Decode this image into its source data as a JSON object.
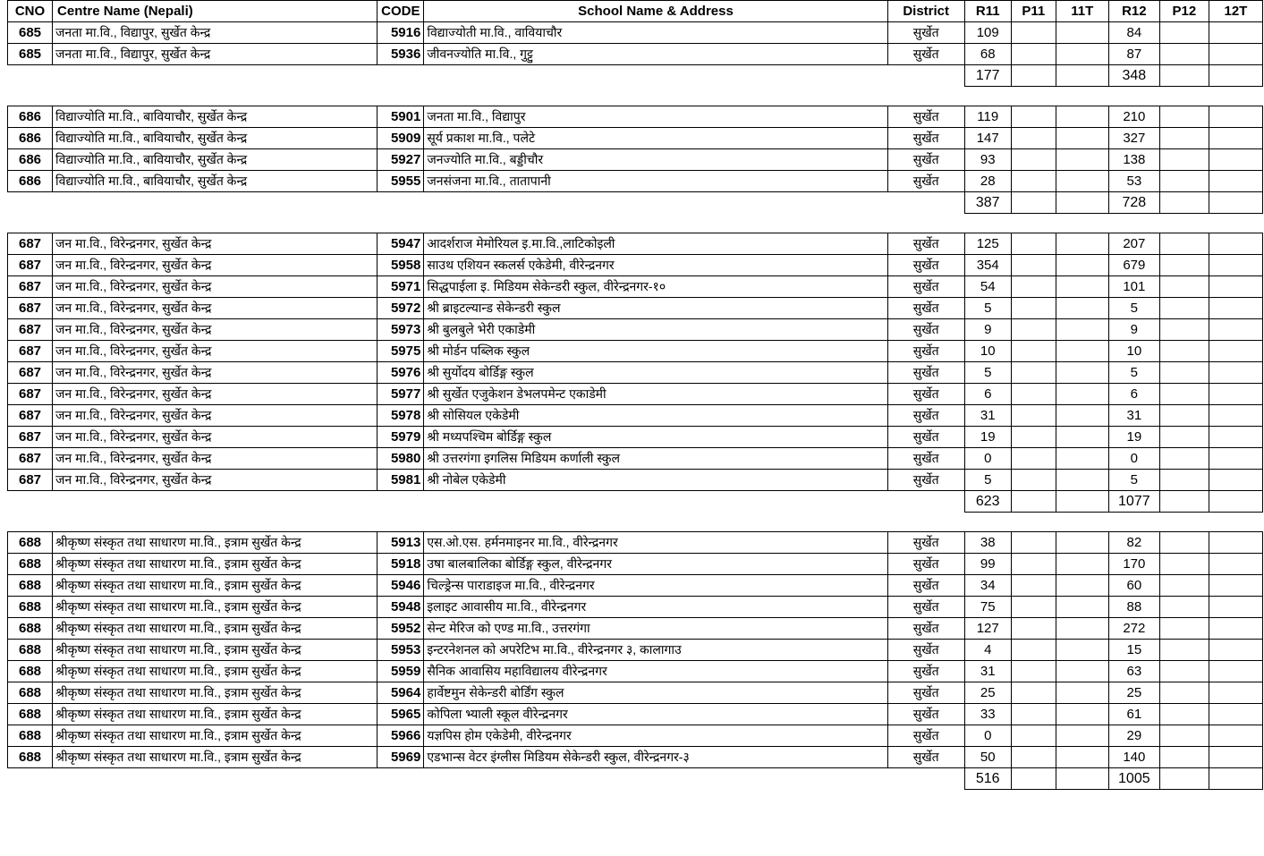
{
  "table": {
    "columns": [
      {
        "key": "cno",
        "label": "CNO"
      },
      {
        "key": "centre",
        "label": "Centre Name (Nepali)"
      },
      {
        "key": "code",
        "label": "CODE"
      },
      {
        "key": "school",
        "label": "School Name & Address"
      },
      {
        "key": "dist",
        "label": "District"
      },
      {
        "key": "r11",
        "label": "R11"
      },
      {
        "key": "p11",
        "label": "P11"
      },
      {
        "key": "t11",
        "label": "11T"
      },
      {
        "key": "r12",
        "label": "R12"
      },
      {
        "key": "p12",
        "label": "P12"
      },
      {
        "key": "t12",
        "label": "12T"
      }
    ],
    "blocks": [
      {
        "cno": "685",
        "centre": "जनता मा.वि., विद्यापुर, सुर्खेत केन्द्र",
        "rows": [
          {
            "code": "5916",
            "school": "विद्याज्योती मा.वि., वावियाचौर",
            "dist": "सुर्खेत",
            "r11": "109",
            "p11": "",
            "t11": "",
            "r12": "84",
            "p12": "",
            "t12": ""
          },
          {
            "code": "5936",
            "school": "जीवनज्योति मा.वि., गुट्टु",
            "dist": "सुर्खेत",
            "r11": "68",
            "p11": "",
            "t11": "",
            "r12": "87",
            "p12": "",
            "t12": ""
          }
        ],
        "total": {
          "r11": "177",
          "p11": "",
          "t11": "",
          "r12": "348",
          "p12": "",
          "t12": ""
        }
      },
      {
        "cno": "686",
        "centre": "विद्याज्योति मा.वि., बावियाचौर, सुर्खेत केन्द्र",
        "rows": [
          {
            "code": "5901",
            "school": "जनता मा.वि., विद्यापुर",
            "dist": "सुर्खेत",
            "r11": "119",
            "p11": "",
            "t11": "",
            "r12": "210",
            "p12": "",
            "t12": ""
          },
          {
            "code": "5909",
            "school": "सूर्य प्रकाश मा.वि., पलेटे",
            "dist": "सुर्खेत",
            "r11": "147",
            "p11": "",
            "t11": "",
            "r12": "327",
            "p12": "",
            "t12": ""
          },
          {
            "code": "5927",
            "school": "जनज्योति मा.वि., बड्डीचौर",
            "dist": "सुर्खेत",
            "r11": "93",
            "p11": "",
            "t11": "",
            "r12": "138",
            "p12": "",
            "t12": ""
          },
          {
            "code": "5955",
            "school": "जनसंजना मा.वि., तातापानी",
            "dist": "सुर्खेत",
            "r11": "28",
            "p11": "",
            "t11": "",
            "r12": "53",
            "p12": "",
            "t12": ""
          }
        ],
        "total": {
          "r11": "387",
          "p11": "",
          "t11": "",
          "r12": "728",
          "p12": "",
          "t12": ""
        }
      },
      {
        "cno": "687",
        "centre": "जन मा.वि., विरेन्द्रनगर, सुर्खेत केन्द्र",
        "rows": [
          {
            "code": "5947",
            "school": "आदर्शराज मेमोरियल इ.मा.वि.,लाटिकोइली",
            "dist": "सुर्खेत",
            "r11": "125",
            "p11": "",
            "t11": "",
            "r12": "207",
            "p12": "",
            "t12": ""
          },
          {
            "code": "5958",
            "school": "साउथ एशियन स्कलर्स एकेडेमी, वीरेन्द्रनगर",
            "dist": "सुर्खेत",
            "r11": "354",
            "p11": "",
            "t11": "",
            "r12": "679",
            "p12": "",
            "t12": ""
          },
          {
            "code": "5971",
            "school": "सिद्धपाईला इ. मिडियम सेकेन्डरी स्कुल, वीरेन्द्रनगर-१०",
            "dist": "सुर्खेत",
            "r11": "54",
            "p11": "",
            "t11": "",
            "r12": "101",
            "p12": "",
            "t12": ""
          },
          {
            "code": "5972",
            "school": "श्री ब्राइटल्यान्ड सेकेन्डरी स्कुल",
            "dist": "सुर्खेत",
            "r11": "5",
            "p11": "",
            "t11": "",
            "r12": "5",
            "p12": "",
            "t12": ""
          },
          {
            "code": "5973",
            "school": "श्री बुलबुले भेरी एकाडेमी",
            "dist": "सुर्खेत",
            "r11": "9",
            "p11": "",
            "t11": "",
            "r12": "9",
            "p12": "",
            "t12": ""
          },
          {
            "code": "5975",
            "school": "श्री मोर्डन पब्लिक स्कुल",
            "dist": "सुर्खेत",
            "r11": "10",
            "p11": "",
            "t11": "",
            "r12": "10",
            "p12": "",
            "t12": ""
          },
          {
            "code": "5976",
            "school": "श्री सुर्योदय बोर्डिङ्ग स्कुल",
            "dist": "सुर्खेत",
            "r11": "5",
            "p11": "",
            "t11": "",
            "r12": "5",
            "p12": "",
            "t12": ""
          },
          {
            "code": "5977",
            "school": "श्री सुर्खेत एजुकेशन डेभलपमेन्ट एकाडेमी",
            "dist": "सुर्खेत",
            "r11": "6",
            "p11": "",
            "t11": "",
            "r12": "6",
            "p12": "",
            "t12": ""
          },
          {
            "code": "5978",
            "school": "श्री सोसियल एकेडेमी",
            "dist": "सुर्खेत",
            "r11": "31",
            "p11": "",
            "t11": "",
            "r12": "31",
            "p12": "",
            "t12": ""
          },
          {
            "code": "5979",
            "school": "श्री मध्यपश्चिम बोर्डिङ्ग स्कुल",
            "dist": "सुर्खेत",
            "r11": "19",
            "p11": "",
            "t11": "",
            "r12": "19",
            "p12": "",
            "t12": ""
          },
          {
            "code": "5980",
            "school": "श्री उत्तरगंगा  इगलिस मिडियम कर्णाली स्कुल",
            "dist": "सुर्खेत",
            "r11": "0",
            "p11": "",
            "t11": "",
            "r12": "0",
            "p12": "",
            "t12": ""
          },
          {
            "code": "5981",
            "school": "श्री नोबेल एकेडेमी",
            "dist": "सुर्खेत",
            "r11": "5",
            "p11": "",
            "t11": "",
            "r12": "5",
            "p12": "",
            "t12": ""
          }
        ],
        "total": {
          "r11": "623",
          "p11": "",
          "t11": "",
          "r12": "1077",
          "p12": "",
          "t12": ""
        }
      },
      {
        "cno": "688",
        "centre": "श्रीकृष्ण संस्कृत तथा साधारण मा.वि., इत्राम सुर्खेत केन्द्र",
        "rows": [
          {
            "code": "5913",
            "school": "एस.ओ.एस. हर्मनमाइनर मा.वि., वीरेन्द्रनगर",
            "dist": "सुर्खेत",
            "r11": "38",
            "p11": "",
            "t11": "",
            "r12": "82",
            "p12": "",
            "t12": ""
          },
          {
            "code": "5918",
            "school": "उषा बालबालिका बोर्डिङ्ग स्कुल, वीरेन्द्रनगर",
            "dist": "सुर्खेत",
            "r11": "99",
            "p11": "",
            "t11": "",
            "r12": "170",
            "p12": "",
            "t12": ""
          },
          {
            "code": "5946",
            "school": "चिल्ड्रेन्स पाराडाइज मा.वि., वीरेन्द्रनगर",
            "dist": "सुर्खेत",
            "r11": "34",
            "p11": "",
            "t11": "",
            "r12": "60",
            "p12": "",
            "t12": ""
          },
          {
            "code": "5948",
            "school": "इलाइट आवासीय मा.वि., वीरेन्द्रनगर",
            "dist": "सुर्खेत",
            "r11": "75",
            "p11": "",
            "t11": "",
            "r12": "88",
            "p12": "",
            "t12": ""
          },
          {
            "code": "5952",
            "school": "सेन्ट मेरिज को एण्ड मा.वि., उत्तरगंगा",
            "dist": "सुर्खेत",
            "r11": "127",
            "p11": "",
            "t11": "",
            "r12": "272",
            "p12": "",
            "t12": ""
          },
          {
            "code": "5953",
            "school": "इन्टरनेशनल को अपरेटिभ मा.वि., वीरेन्द्रनगर ३, कालागाउ",
            "dist": "सुर्खेत",
            "r11": "4",
            "p11": "",
            "t11": "",
            "r12": "15",
            "p12": "",
            "t12": ""
          },
          {
            "code": "5959",
            "school": "सैनिक आवासिय महाविद्यालय वीरेन्द्रनगर",
            "dist": "सुर्खेत",
            "r11": "31",
            "p11": "",
            "t11": "",
            "r12": "63",
            "p12": "",
            "t12": ""
          },
          {
            "code": "5964",
            "school": "हार्वेष्टमुन सेकेन्डरी बोर्डिंग स्कुल",
            "dist": "सुर्खेत",
            "r11": "25",
            "p11": "",
            "t11": "",
            "r12": "25",
            "p12": "",
            "t12": ""
          },
          {
            "code": "5965",
            "school": "कोपिला भ्याली स्कूल वीरेन्द्रनगर",
            "dist": "सुर्खेत",
            "r11": "33",
            "p11": "",
            "t11": "",
            "r12": "61",
            "p12": "",
            "t12": ""
          },
          {
            "code": "5966",
            "school": "यज्ञपिस होम एकेडेमी, वीरेन्द्रनगर",
            "dist": "सुर्खेत",
            "r11": "0",
            "p11": "",
            "t11": "",
            "r12": "29",
            "p12": "",
            "t12": ""
          },
          {
            "code": "5969",
            "school": "एडभान्स वेटर इंग्लीस मिडियम सेकेन्डरी स्कुल, वीरेन्द्रनगर-३",
            "dist": "सुर्खेत",
            "r11": "50",
            "p11": "",
            "t11": "",
            "r12": "140",
            "p12": "",
            "t12": ""
          }
        ],
        "total": {
          "r11": "516",
          "p11": "",
          "t11": "",
          "r12": "1005",
          "p12": "",
          "t12": ""
        }
      }
    ]
  }
}
